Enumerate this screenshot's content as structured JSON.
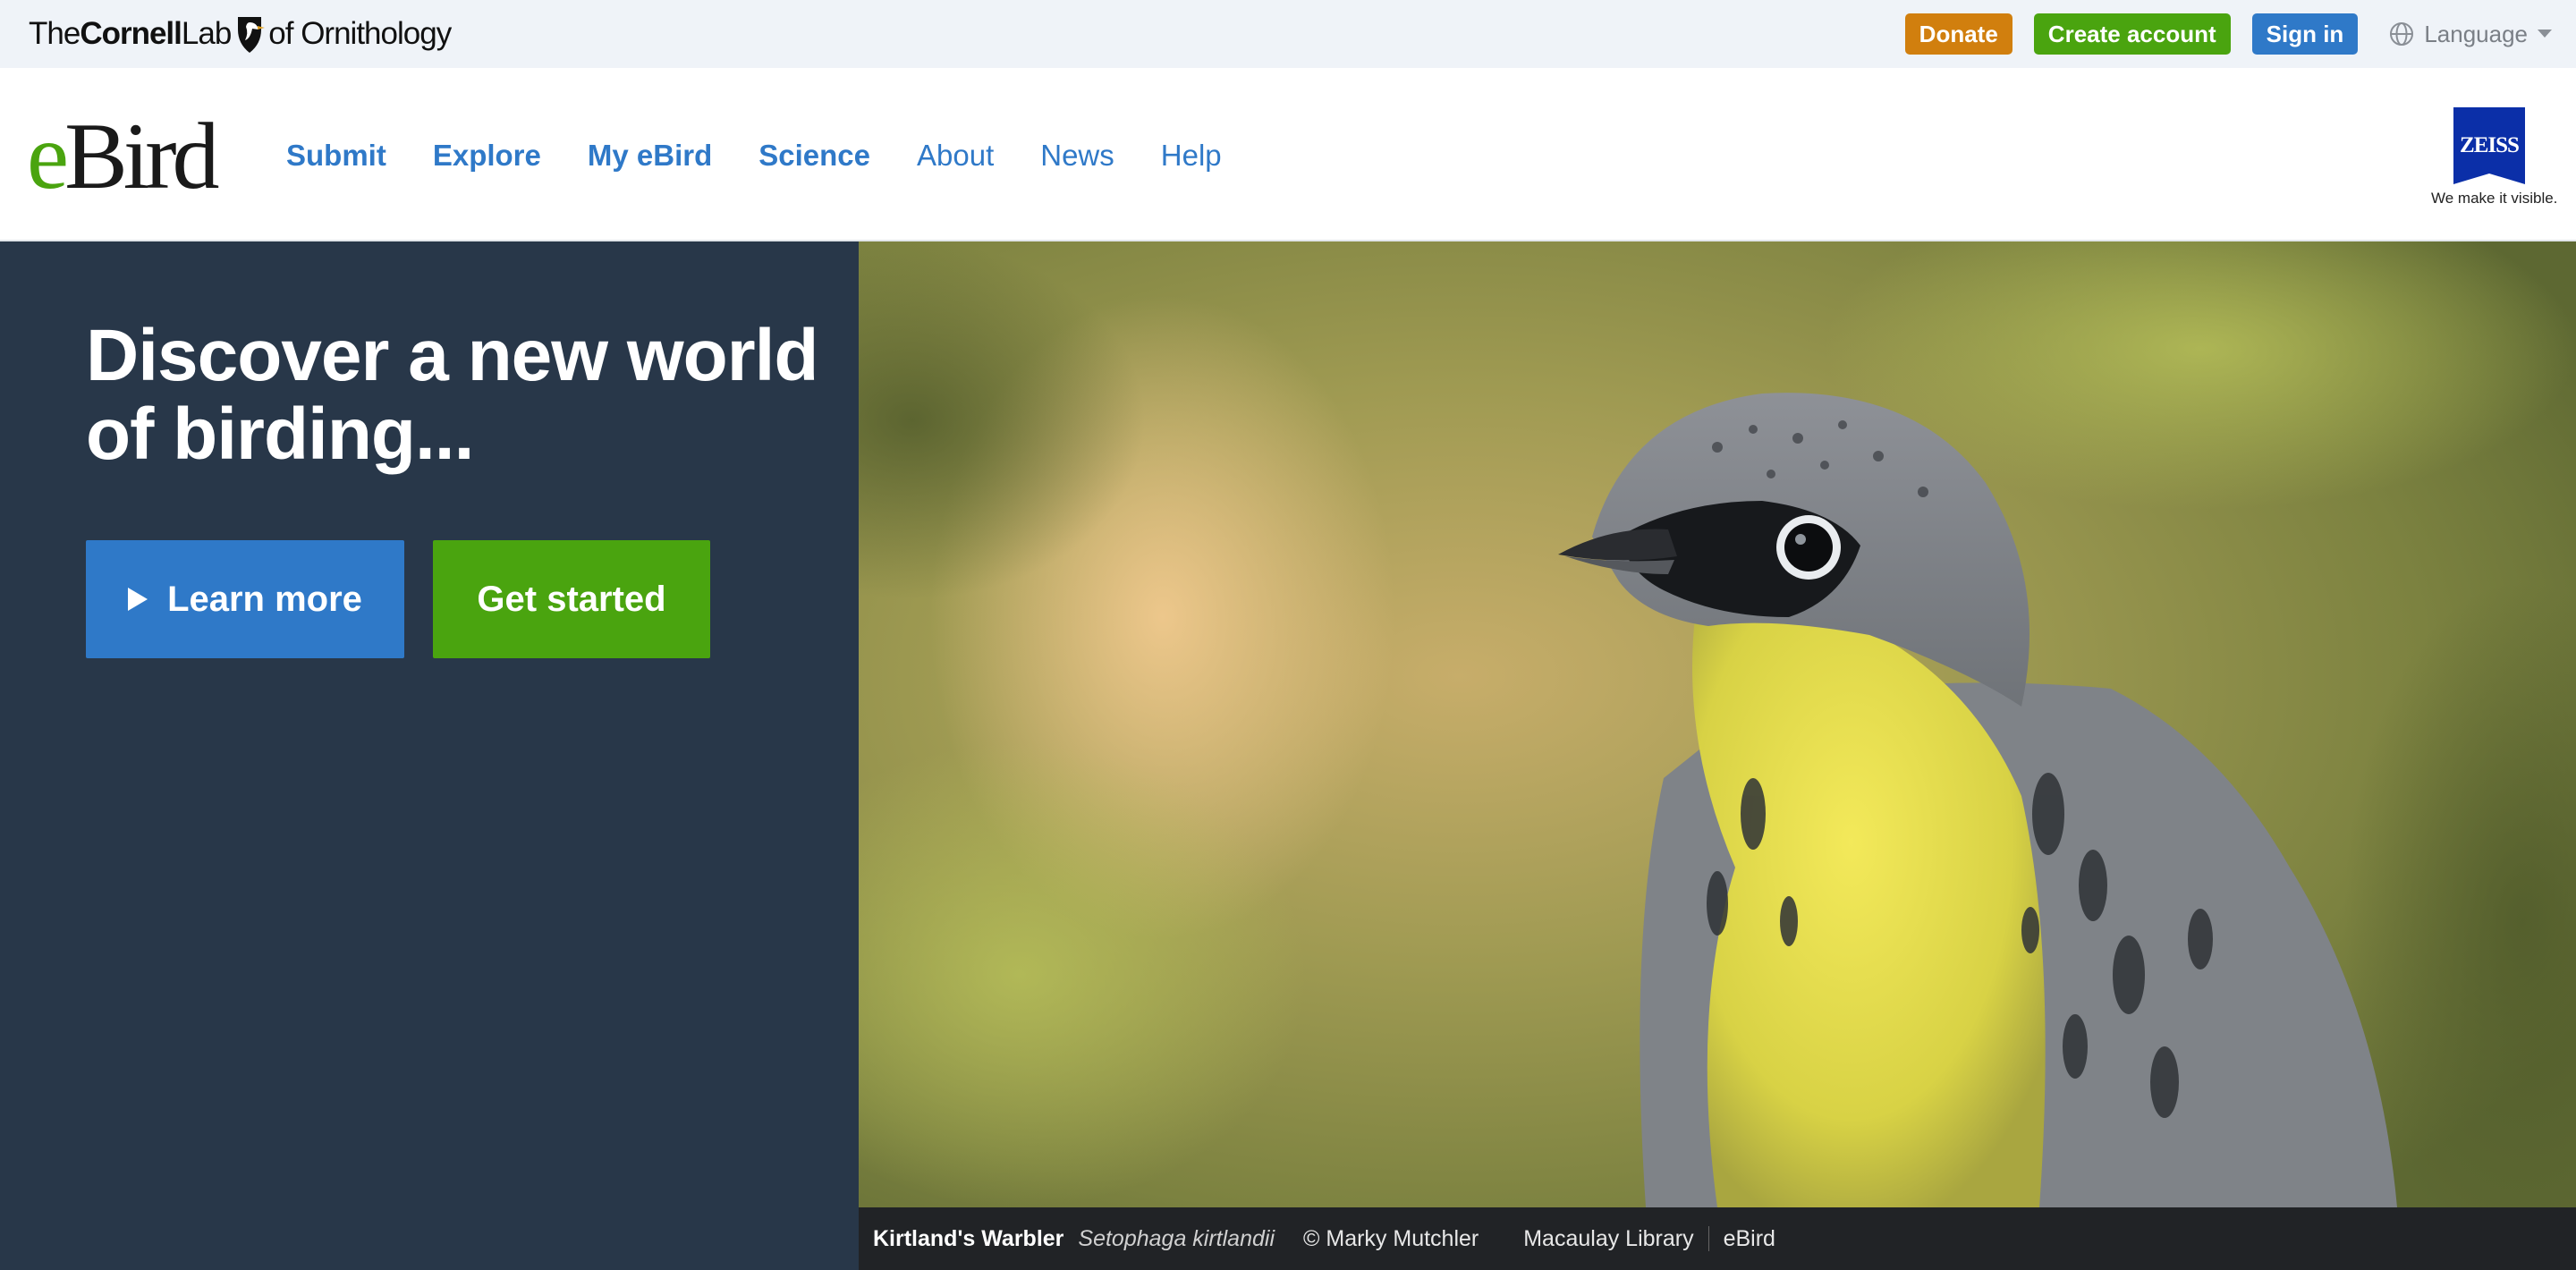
{
  "header": {
    "lab_logo": {
      "the": "The",
      "cornell": "Cornell",
      "lab": "Lab",
      "of": "of Ornithology"
    },
    "donate": "Donate",
    "create_account": "Create account",
    "sign_in": "Sign in",
    "language": "Language",
    "icons": [
      "cornell-bird-icon",
      "globe-icon",
      "caret-down-icon"
    ]
  },
  "nav": {
    "logo_e": "e",
    "logo_bird": "Bird",
    "items": [
      {
        "label": "Submit",
        "weight": "bold"
      },
      {
        "label": "Explore",
        "weight": "bold"
      },
      {
        "label": "My eBird",
        "weight": "bold"
      },
      {
        "label": "Science",
        "weight": "bold"
      },
      {
        "label": "About",
        "weight": "normal"
      },
      {
        "label": "News",
        "weight": "normal"
      },
      {
        "label": "Help",
        "weight": "normal"
      }
    ],
    "sponsor": {
      "brand": "ZEISS",
      "tagline": "We make it visible."
    }
  },
  "hero": {
    "title": "Discover a new world of birding...",
    "learn_more": "Learn more",
    "get_started": "Get started"
  },
  "photo_caption": {
    "common_name": "Kirtland's Warbler",
    "scientific_name": "Setophaga kirtlandii",
    "credit": "© Marky Mutchler",
    "library": "Macaulay Library",
    "source": "eBird"
  },
  "colors": {
    "blue": "#2f79c8",
    "green": "#4aa40f",
    "orange": "#d17f0e",
    "hero_panel": "#283749",
    "zeiss_blue": "#0b2fa8"
  }
}
